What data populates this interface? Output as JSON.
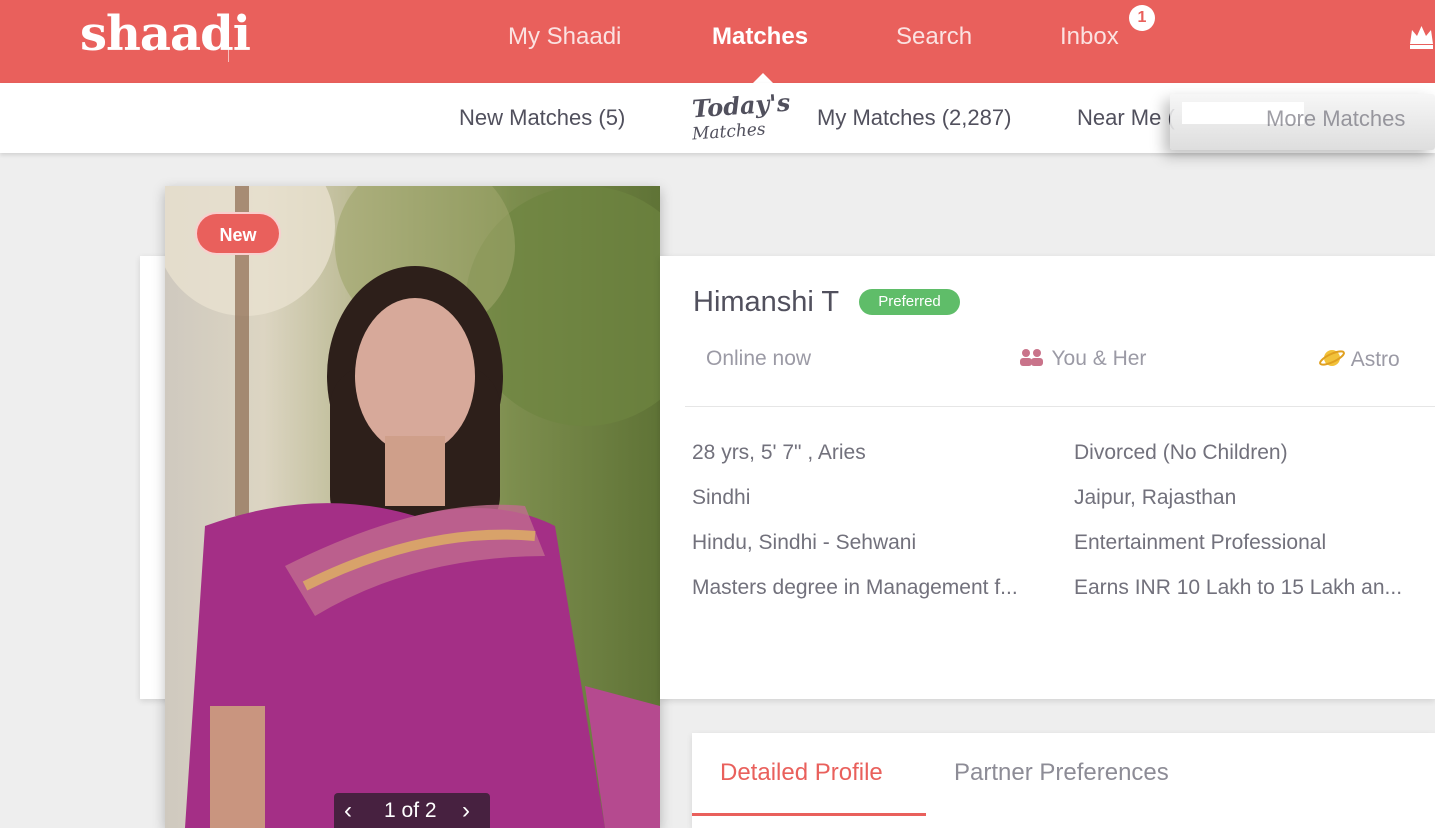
{
  "brand": {
    "logo": "shaadi"
  },
  "nav": {
    "items": [
      {
        "label": "My Shaadi"
      },
      {
        "label": "Matches"
      },
      {
        "label": "Search"
      },
      {
        "label": "Inbox"
      }
    ],
    "active": "Matches",
    "inbox_badge": "1",
    "crown_icon": "crown-icon"
  },
  "subnav": {
    "new_matches": "New Matches (5)",
    "todays_matches_line1": "Today's",
    "todays_matches_line2": "Matches",
    "my_matches": "My Matches (2,287)",
    "near_me": "Near Me (",
    "more_matches": "More Matches"
  },
  "profile": {
    "badge": "New",
    "photo_pager": {
      "prev_icon": "chevron-left-icon",
      "count": "1 of 2",
      "next_icon": "chevron-right-icon"
    },
    "name": "Himanshi T",
    "tag": "Preferred",
    "online_status": "Online now",
    "you_and_her": "You & Her",
    "astro": "Astro",
    "details_left": [
      "28 yrs, 5' 7\" , Aries",
      "Sindhi",
      "Hindu, Sindhi - Sehwani",
      "Masters degree in Management f..."
    ],
    "details_right": [
      "Divorced (No Children)",
      "Jaipur, Rajasthan",
      "Entertainment Professional",
      "Earns INR 10 Lakh to 15 Lakh an..."
    ]
  },
  "tabs": [
    {
      "label": "Detailed Profile"
    },
    {
      "label": "Partner Preferences"
    }
  ],
  "colors": {
    "brand": "#e9605c",
    "preferred": "#5fbd69",
    "text": "#51505d"
  }
}
